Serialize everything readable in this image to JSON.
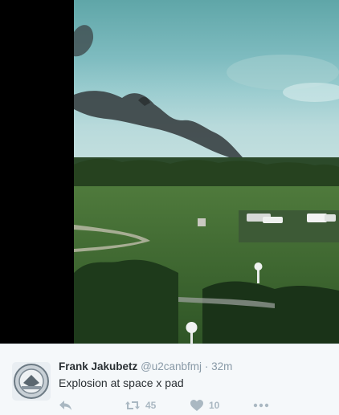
{
  "tweet": {
    "display_name": "Frank Jakubetz",
    "handle": "@u2canbfmj",
    "separator": "·",
    "timestamp": "32m",
    "text": "Explosion at space x pad",
    "retweet_count": "45",
    "like_count": "10"
  },
  "icons": {
    "reply": "reply-icon",
    "retweet": "retweet-icon",
    "like": "heart-icon",
    "more": "more-icon"
  },
  "colors": {
    "name": "#292f33",
    "meta": "#8899a6",
    "action": "#aab8c2",
    "background": "#f5f8fa"
  }
}
